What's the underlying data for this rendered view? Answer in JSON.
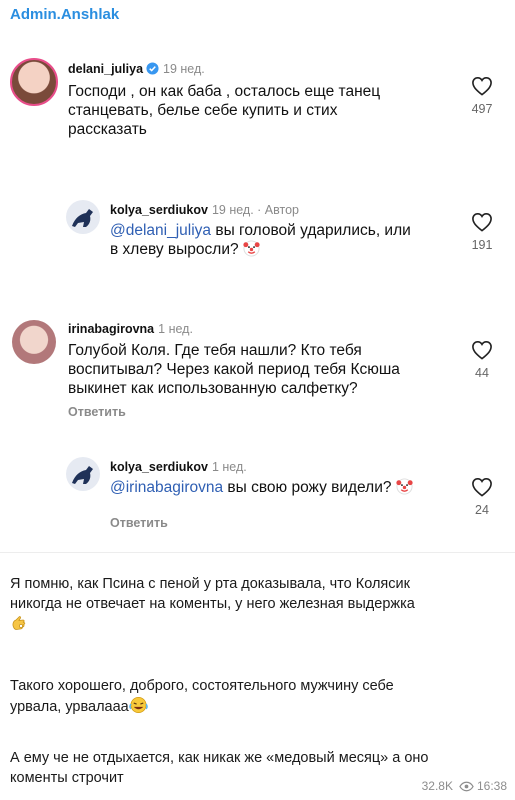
{
  "channel": {
    "name": "Admin.Anshlak"
  },
  "screenshot": {
    "comments": [
      {
        "username": "delani_juliya",
        "meta": "19 нед.",
        "text_lines": [
          "Господи , он как баба , осталось еще танец",
          "станцевать, белье себе купить и стих",
          "рассказать"
        ],
        "likes": "497"
      },
      {
        "username": "kolya_serdiukov",
        "meta": "19 нед. · Автор",
        "mention": "@delani_juliya",
        "text_line1_rest": " вы головой ударились, или",
        "text_line2": "в хлеву выросли? ",
        "likes": "191"
      },
      {
        "username": "irinabagirovna",
        "meta": "1 нед.",
        "text_lines": [
          "Голубой Коля. Где тебя нашли? Кто тебя",
          "воспитывал? Через какой период тебя Ксюша",
          "выкинет как использованную салфетку?"
        ],
        "reply": "Ответить",
        "likes": "44"
      },
      {
        "username": "kolya_serdiukov",
        "meta": "1 нед.",
        "mention": "@irinabagirovna",
        "text_rest": " вы свою рожу видели? ",
        "reply": "Ответить",
        "likes": "24"
      }
    ]
  },
  "post": {
    "paragraphs": [
      [
        "Я помню, как Псина с пеной у рта доказывала, что Колясик",
        "никогда не отвечает на коменты, у него железная выдержка"
      ],
      [
        "Такого хорошего, доброго, состоятельного мужчину себе",
        "урвала, урвалааа"
      ],
      [
        "А ему че не отдыхается, как никак же «медовый месяц» а оно",
        "коменты строчит"
      ]
    ]
  },
  "footer": {
    "views": "32.8K",
    "time": "16:38"
  },
  "icons": [
    "heart-icon",
    "verified-badge-icon",
    "clown-emoji-icon",
    "ok-hand-emoji-icon",
    "laughing-emoji-icon",
    "eye-icon"
  ],
  "colors": {
    "channel": "#2a8ee0",
    "mention": "#2f5fb3",
    "meta": "#8a8a8a"
  }
}
